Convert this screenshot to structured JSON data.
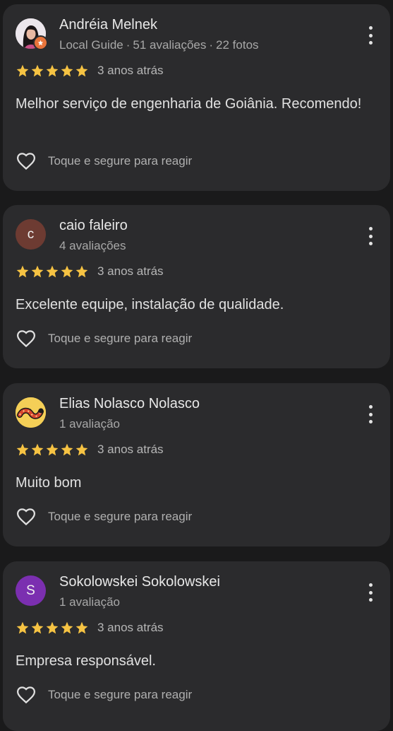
{
  "reviews": [
    {
      "name": "Andréia Melnek",
      "meta": [
        "Local Guide",
        "51 avaliações",
        "22 fotos"
      ],
      "avatar_initial": "",
      "avatar_color": "#e9e4ea",
      "rating": 5,
      "time": "3 anos atrás",
      "text": "Melhor serviço de engenharia de Goiânia. Recomendo!",
      "react_label": "Toque e segure para reagir"
    },
    {
      "name": "caio faleiro",
      "meta": [
        "4 avaliações"
      ],
      "avatar_initial": "c",
      "avatar_color": "#6d3b32",
      "rating": 5,
      "time": "3 anos atrás",
      "text": "Excelente equipe, instalação de qualidade.",
      "react_label": "Toque e segure para reagir"
    },
    {
      "name": "Elias Nolasco Nolasco",
      "meta": [
        "1 avaliação"
      ],
      "avatar_initial": "",
      "avatar_color": "#f4cf57",
      "rating": 5,
      "time": "3 anos atrás",
      "text": "Muito bom",
      "react_label": "Toque e segure para reagir"
    },
    {
      "name": "Sokolowskei Sokolowskei",
      "meta": [
        "1 avaliação"
      ],
      "avatar_initial": "S",
      "avatar_color": "#7b2fb0",
      "rating": 5,
      "time": "3 anos atrás",
      "text": "Empresa responsável.",
      "react_label": "Toque e segure para reagir"
    }
  ],
  "colors": {
    "background": "#1a1a1b",
    "card": "#2b2b2d",
    "star": "#f6c343",
    "local_guide_badge": "#e8743b"
  },
  "icons": {
    "star": "star-icon",
    "heart": "heart-outline-icon",
    "more": "more-vert-icon",
    "badge": "local-guide-badge-icon"
  }
}
